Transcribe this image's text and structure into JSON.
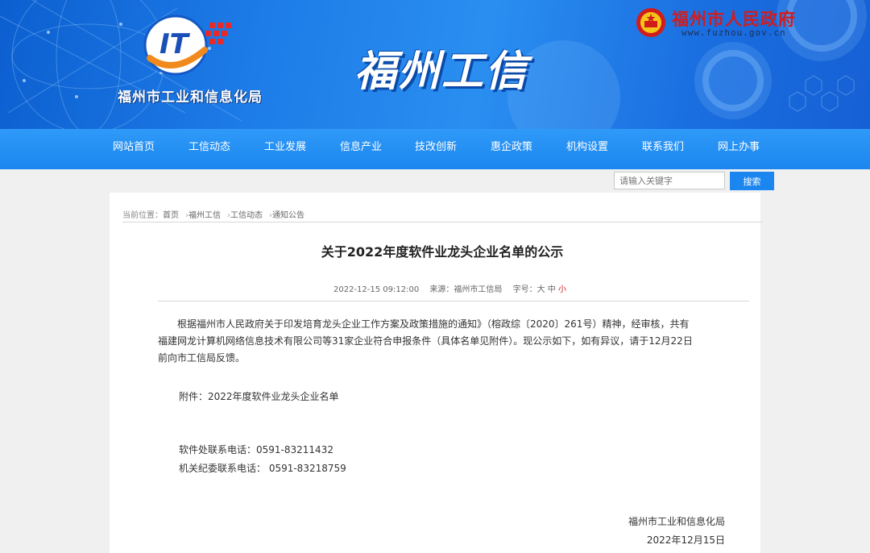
{
  "banner": {
    "bureau_name": "福州市工业和信息化局",
    "brand_title": "福州工信",
    "gov_name": "福州市人民政府",
    "gov_url": "www.fuzhou.gov.cn",
    "logo_icon": "fuzhou-it-bureau-logo",
    "emblem_icon": "national-emblem"
  },
  "nav": {
    "items": [
      {
        "label": "网站首页"
      },
      {
        "label": "工信动态"
      },
      {
        "label": "工业发展"
      },
      {
        "label": "信息产业"
      },
      {
        "label": "技改创新"
      },
      {
        "label": "惠企政策"
      },
      {
        "label": "机构设置"
      },
      {
        "label": "联系我们"
      },
      {
        "label": "网上办事"
      }
    ]
  },
  "search": {
    "placeholder": "请输入关键字",
    "button_label": "搜索"
  },
  "breadcrumb": {
    "prefix": "当前位置：",
    "items": [
      "首页",
      "福州工信",
      "工信动态",
      "通知公告"
    ],
    "separator": "›"
  },
  "article": {
    "title": "关于2022年度软件业龙头企业名单的公示",
    "date": "2022-12-15 09:12:00",
    "source_label": "来源：",
    "source": "福州市工信局",
    "font_size_label": "字号：",
    "font_sizes": [
      "大",
      "中",
      "小"
    ],
    "paragraph_lines": [
      "根据福州市人民政府关于印发培育龙头企业工作方案及政策措施的通知》（榕政综〔2020〕261号）精神，经审核，共有",
      "福建网龙计算机网络信息技术有限公司等31家企业符合申报条件（具体名单见附件）。现公示如下，如有异议，请于12月22日",
      "前向市工信局反馈。"
    ],
    "attachment": "附件：2022年度软件业龙头企业名单",
    "contact_software": "软件处联系电话：0591-83211432",
    "contact_discipline": "机关纪委联系电话：  0591-83218759",
    "signature_org": "福州市工业和信息化局",
    "signature_date": "2022年12月15日"
  },
  "colors": {
    "nav_blue": "#1b86ef",
    "gov_red": "#d21c1c",
    "banner_blue": "#1d7ce8"
  }
}
